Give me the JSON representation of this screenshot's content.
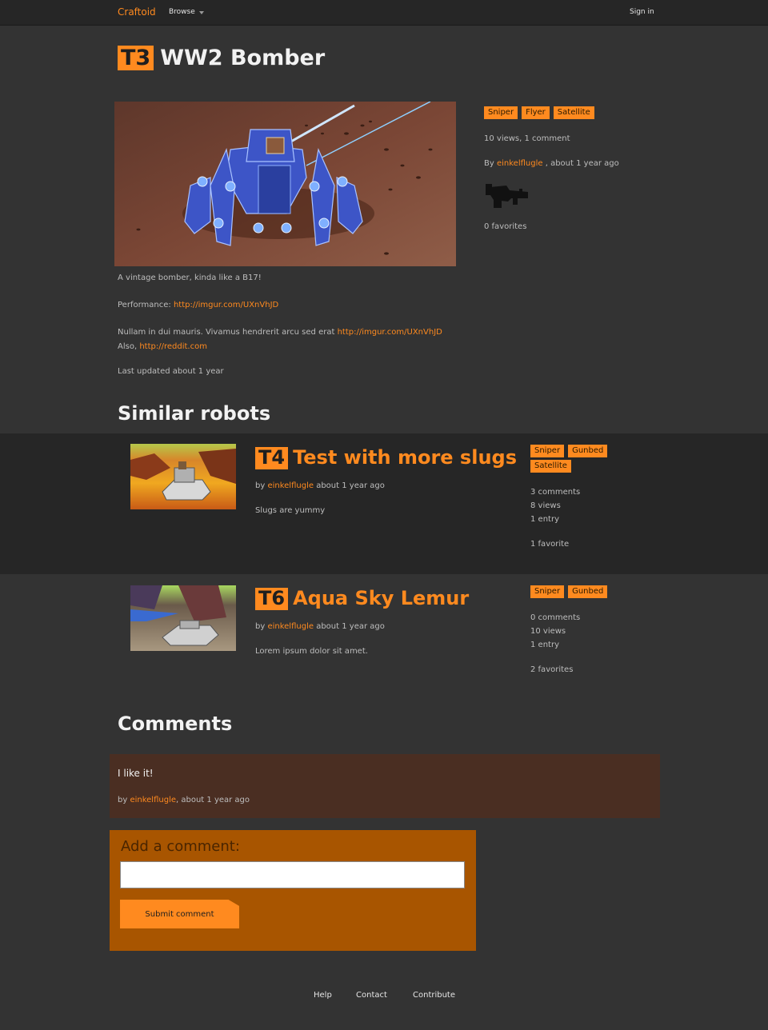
{
  "nav": {
    "brand": "Craftoid",
    "browse": "Browse",
    "signin": "Sign in"
  },
  "robot": {
    "tier": "T3",
    "name": "WW2 Bomber",
    "tags": [
      "Sniper",
      "Flyer",
      "Satellite"
    ],
    "stats": "10 views, 1 comment",
    "by_prefix": "By",
    "author": "einkelflugle",
    "by_suffix": ", about 1 year ago",
    "favorites": "0 favorites",
    "description": "A vintage bomber, kinda like a B17!",
    "performance_label": "Performance:",
    "performance_link": "http://imgur.com/UXnVhJD",
    "extra_text": "Nullam in dui mauris. Vivamus hendrerit arcu sed erat",
    "extra_link": "http://imgur.com/UXnVhJD",
    "also_label": "Also,",
    "also_link": "http://reddit.com",
    "updated": "Last updated about 1 year"
  },
  "similar": {
    "heading": "Similar robots",
    "items": [
      {
        "tier": "T4",
        "name": "Test with more slugs",
        "by": "by",
        "author": "einkelflugle",
        "time": "about 1 year ago",
        "description": "Slugs are yummy",
        "tags": [
          "Sniper",
          "Gunbed",
          "Satellite"
        ],
        "comments": "3 comments",
        "views": "8 views",
        "entries": "1 entry",
        "favorites": "1 favorite"
      },
      {
        "tier": "T6",
        "name": "Aqua Sky Lemur",
        "by": "by",
        "author": "einkelflugle",
        "time": "about 1 year ago",
        "description": "Lorem ipsum dolor sit amet.",
        "tags": [
          "Sniper",
          "Gunbed"
        ],
        "comments": "0 comments",
        "views": "10 views",
        "entries": "1 entry",
        "favorites": "2 favorites"
      }
    ]
  },
  "comments": {
    "heading": "Comments",
    "list": [
      {
        "body": "I like it!",
        "by": "by",
        "author": "einkelflugle",
        "time": ", about 1 year ago"
      }
    ],
    "form": {
      "label": "Add a comment:",
      "value": "",
      "submit": "Submit comment"
    }
  },
  "footer": {
    "help": "Help",
    "contact": "Contact",
    "contribute": "Contribute"
  },
  "colors": {
    "accent": "#ff8a1f",
    "background": "#333333",
    "navbar": "#262626",
    "comment_bg": "#4a2e22",
    "form_bg": "#a85500"
  },
  "icons": {
    "weapon": "gun-silhouette-icon"
  }
}
